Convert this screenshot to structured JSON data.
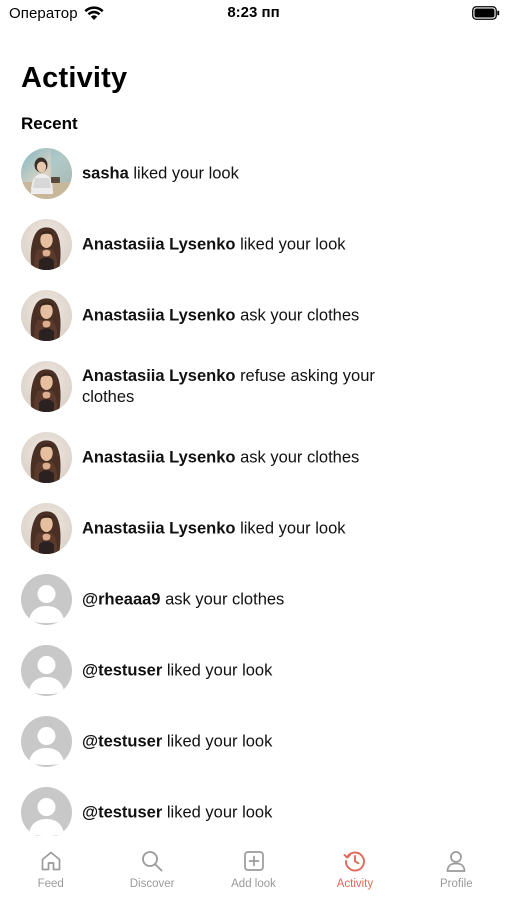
{
  "status_bar": {
    "carrier": "Оператор",
    "time": "8:23 пп"
  },
  "header": {
    "title": "Activity",
    "section": "Recent"
  },
  "activities": [
    {
      "user": "sasha",
      "action": "liked your look",
      "avatar": "photo-sasha"
    },
    {
      "user": "Anastasiia Lysenko",
      "action": "liked your look",
      "avatar": "photo-anastasiia"
    },
    {
      "user": "Anastasiia Lysenko",
      "action": "ask your clothes",
      "avatar": "photo-anastasiia"
    },
    {
      "user": "Anastasiia Lysenko",
      "action": "refuse asking your clothes",
      "avatar": "photo-anastasiia"
    },
    {
      "user": "Anastasiia Lysenko",
      "action": "ask your clothes",
      "avatar": "photo-anastasiia"
    },
    {
      "user": "Anastasiia Lysenko",
      "action": "liked your look",
      "avatar": "photo-anastasiia"
    },
    {
      "user": "@rheaaa9",
      "action": "ask your clothes",
      "avatar": "default-avatar"
    },
    {
      "user": "@testuser",
      "action": "liked your look",
      "avatar": "default-avatar"
    },
    {
      "user": "@testuser",
      "action": "liked your look",
      "avatar": "default-avatar"
    },
    {
      "user": "@testuser",
      "action": "liked your look",
      "avatar": "default-avatar"
    }
  ],
  "tabs": [
    {
      "label": "Feed",
      "icon": "home-icon",
      "active": false
    },
    {
      "label": "Discover",
      "icon": "search-icon",
      "active": false
    },
    {
      "label": "Add look",
      "icon": "plus-square-icon",
      "active": false
    },
    {
      "label": "Activity",
      "icon": "history-icon",
      "active": true
    },
    {
      "label": "Profile",
      "icon": "person-icon",
      "active": false
    }
  ],
  "colors": {
    "accent": "#e06a5a",
    "inactive": "#9a9a9a",
    "text": "#111111",
    "placeholder_avatar": "#c8c8c8"
  }
}
